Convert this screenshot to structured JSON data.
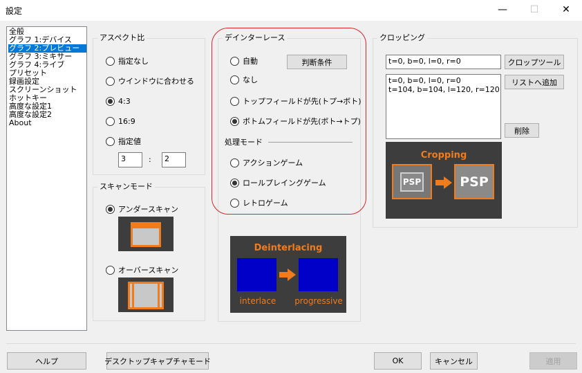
{
  "window": {
    "title": "設定",
    "minimize_glyph": "—",
    "maximize_glyph": "☐",
    "close_glyph": "✕"
  },
  "nav": {
    "items": [
      {
        "label": "全般",
        "selected": false
      },
      {
        "label": "グラフ 1:デバイス",
        "selected": false
      },
      {
        "label": "グラフ 2:プレビュー",
        "selected": true
      },
      {
        "label": "グラフ 3:ミキサー",
        "selected": false
      },
      {
        "label": "グラフ 4:ライブ",
        "selected": false
      },
      {
        "label": "プリセット",
        "selected": false
      },
      {
        "label": "録画設定",
        "selected": false
      },
      {
        "label": "スクリーンショット",
        "selected": false
      },
      {
        "label": "ホットキー",
        "selected": false
      },
      {
        "label": "高度な設定1",
        "selected": false
      },
      {
        "label": "高度な設定2",
        "selected": false
      },
      {
        "label": "About",
        "selected": false
      }
    ]
  },
  "aspect": {
    "title": "アスペクト比",
    "options": [
      {
        "label": "指定なし",
        "checked": false
      },
      {
        "label": "ウインドウに合わせる",
        "checked": false
      },
      {
        "label": "4:3",
        "checked": true
      },
      {
        "label": "16:9",
        "checked": false
      },
      {
        "label": "指定値",
        "checked": false
      }
    ],
    "value_w": "3",
    "colon": ":",
    "value_h": "2"
  },
  "scan": {
    "title": "スキャンモード",
    "underscan_label": "アンダースキャン",
    "underscan_checked": true,
    "overscan_label": "オーバースキャン",
    "overscan_checked": false
  },
  "deinterlace": {
    "title": "デインターレース",
    "auto_label": "自動",
    "auto_checked": false,
    "criteria_button": "判断条件",
    "none_label": "なし",
    "none_checked": false,
    "top_field_label": "トップフィールドが先(トプ→ボト)",
    "top_field_checked": false,
    "bottom_field_label": "ボトムフィールドが先(ボト→トプ)",
    "bottom_field_checked": true,
    "process_mode_title": "処理モード",
    "modes": [
      {
        "label": "アクションゲーム",
        "checked": false
      },
      {
        "label": "ロールプレイングゲーム",
        "checked": true
      },
      {
        "label": "レトロゲーム",
        "checked": false
      }
    ],
    "illustration": {
      "title": "Deinterlacing",
      "left_caption": "interlace",
      "right_caption": "progressive"
    }
  },
  "cropping": {
    "title": "クロッピング",
    "current_value": "t=0, b=0, l=0, r=0",
    "crop_tool_button": "クロップツール",
    "list_items": [
      "t=0, b=0, l=0, r=0",
      "t=104, b=104, l=120, r=120"
    ],
    "add_to_list_button": "リストへ追加",
    "delete_button": "削除",
    "illustration": {
      "title": "Cropping",
      "left_label": "PSP",
      "right_label": "PSP"
    }
  },
  "footer": {
    "help": "ヘルプ",
    "desktop_capture": "デスクトップキャプチャモード",
    "ok": "OK",
    "cancel": "キャンセル",
    "apply": "適用"
  },
  "colors": {
    "accent": "#0078d7",
    "highlight_ring": "#d9252a",
    "illustration_orange": "#f07c1d",
    "illustration_bg": "#3d3d3d",
    "moon_blue": "#0000c8",
    "moon_yellow": "#ffe000"
  }
}
